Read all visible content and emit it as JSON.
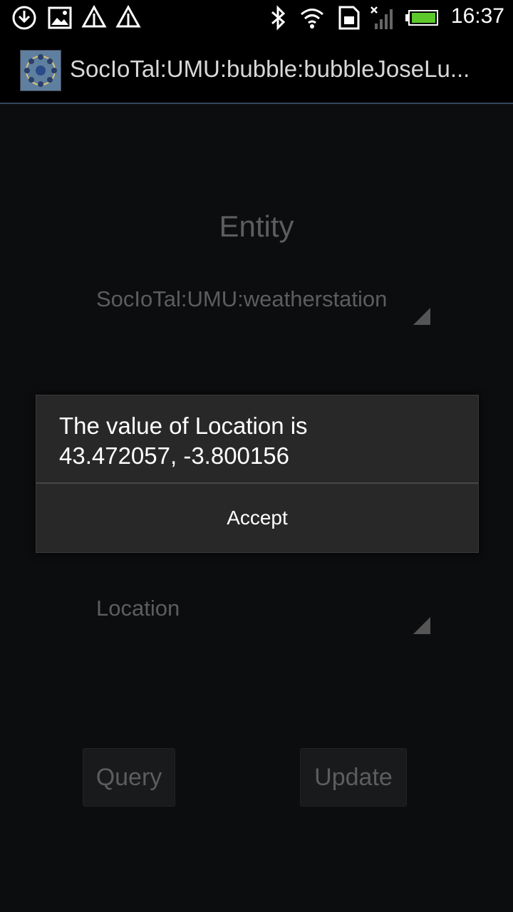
{
  "status_bar": {
    "time": "16:37",
    "icons": [
      "download-icon",
      "image-icon",
      "signal-alert-icon",
      "signal-alert-icon",
      "bluetooth-icon",
      "wifi-icon",
      "sim-icon",
      "cell-signal-icon",
      "battery-icon"
    ]
  },
  "action_bar": {
    "title": "SocIoTal:UMU:bubble:bubbleJoseLu..."
  },
  "form": {
    "entity_label": "Entity",
    "entity_value": "SocIoTal:UMU:weatherstation",
    "attribute_value": "Location",
    "query_label": "Query",
    "update_label": "Update"
  },
  "dialog": {
    "message_line1": "The value of Location is",
    "message_line2": "43.472057, -3.800156",
    "accept_label": "Accept"
  }
}
